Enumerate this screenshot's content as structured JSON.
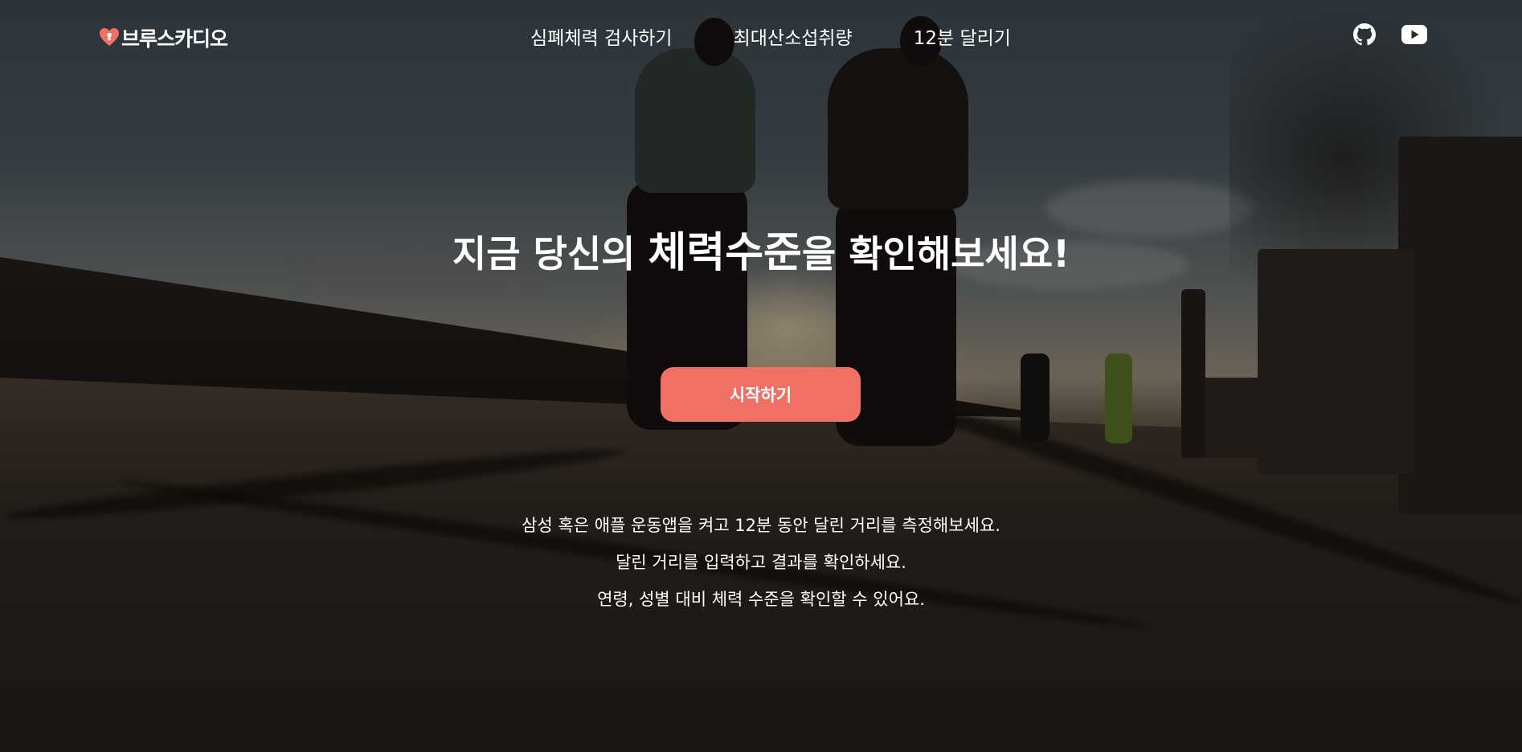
{
  "header": {
    "logo_text": "브루스카디오",
    "logo_icon": "heart-keyhole-icon",
    "nav": [
      {
        "label": "심폐체력 검사하기"
      },
      {
        "label": "최대산소섭취량"
      },
      {
        "label": "12분 달리기"
      }
    ],
    "social": [
      {
        "icon": "github-icon"
      },
      {
        "icon": "youtube-icon"
      }
    ]
  },
  "hero": {
    "headline_before": "지금 당신의 ",
    "headline_emphasis": "체력수준",
    "headline_after": "을 확인해보세요!",
    "cta_label": "시작하기",
    "description": [
      "삼성 혹은 애플 운동앱을 켜고 12분 동안 달린 거리를 측정해보세요.",
      "달린 거리를 입력하고 결과를 확인하세요.",
      "연령, 성별 대비 체력 수준을 확인할 수 있어요."
    ],
    "background": "runners-at-sunset-photo"
  },
  "colors": {
    "accent": "#f07065",
    "text": "#ffffff"
  }
}
